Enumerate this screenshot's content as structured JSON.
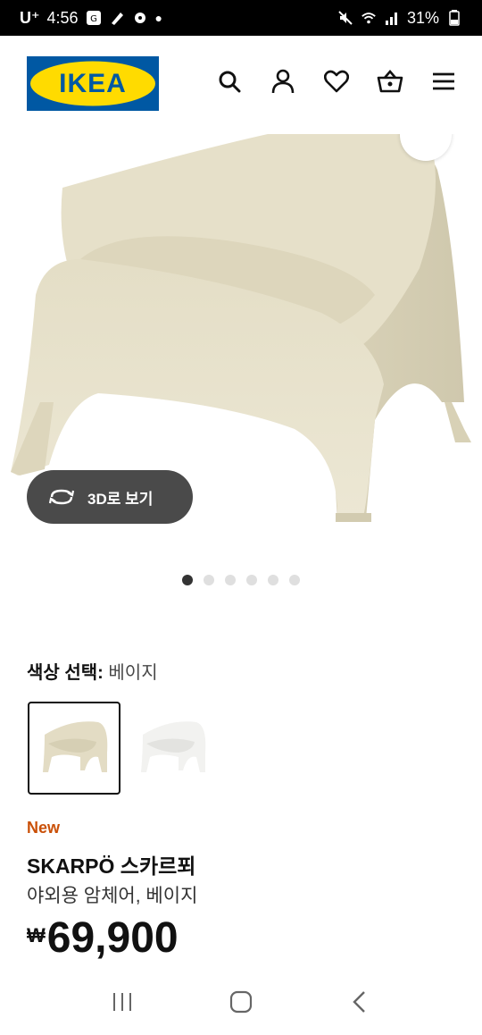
{
  "status_bar": {
    "carrier": "U⁺",
    "time": "4:56",
    "battery": "31%"
  },
  "header": {
    "logo_text": "IKEA",
    "icons": [
      "search-icon",
      "user-icon",
      "heart-icon",
      "cart-icon",
      "menu-icon"
    ]
  },
  "hero": {
    "view3d_label": "3D로 보기",
    "image_count": 6,
    "active_index": 0
  },
  "color": {
    "label": "색상 선택:",
    "value": "베이지",
    "options": [
      "beige",
      "white"
    ]
  },
  "product": {
    "tag": "New",
    "name": "SKARPÖ 스카르푀",
    "description": "야외용 암체어, 베이지",
    "currency": "₩",
    "price": "69,900"
  },
  "colors": {
    "status_bg": "#000000",
    "ikea_blue": "#0058a3",
    "ikea_yellow": "#ffdb00",
    "new_orange": "#ca5008",
    "chair_beige": "#e8e2cc",
    "button_gray": "#4a4a4a"
  }
}
